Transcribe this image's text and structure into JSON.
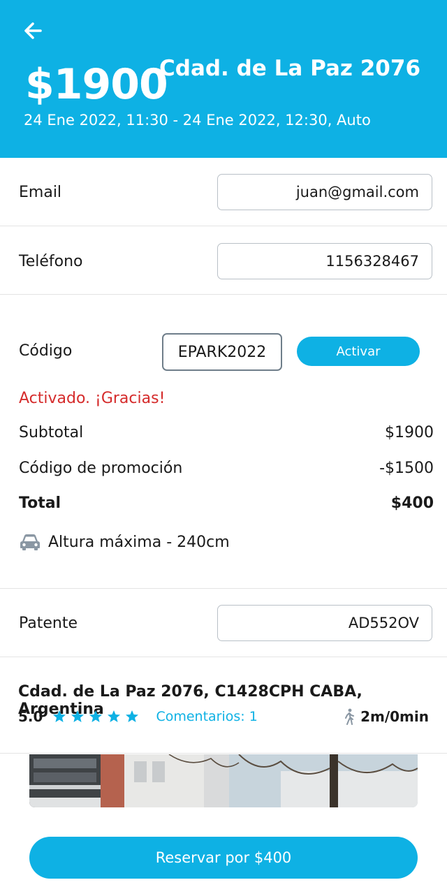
{
  "header": {
    "price": "$1900",
    "title": "Cdad. de La Paz 2076",
    "subtitle": "24 Ene 2022, 11:30 - 24 Ene 2022, 12:30, Auto"
  },
  "form": {
    "email_label": "Email",
    "email_value": "juan@gmail.com",
    "phone_label": "Teléfono",
    "phone_value": "1156328467",
    "code_label": "Código",
    "code_value": "EPARK2022",
    "activate_label": "Activar",
    "success_message": "Activado. ¡Gracias!"
  },
  "summary": {
    "subtotal_label": "Subtotal",
    "subtotal_value": "$1900",
    "promo_label": "Código de promoción",
    "promo_value": "-$1500",
    "total_label": "Total",
    "total_value": "$400"
  },
  "height_info": {
    "icon": "car-icon",
    "text": "Altura máxima - 240cm"
  },
  "plate": {
    "label": "Patente",
    "value": "AD552OV"
  },
  "location": {
    "address": "Cdad. de La Paz 2076, C1428CPH CABA, Argentina",
    "rating": "5.0",
    "stars": 5,
    "comments": "Comentarios: 1",
    "distance": "2m/0min"
  },
  "cta": {
    "reserve_label": "Reservar por $400"
  },
  "colors": {
    "accent": "#0eb1e4",
    "success": "#d52b2b"
  }
}
